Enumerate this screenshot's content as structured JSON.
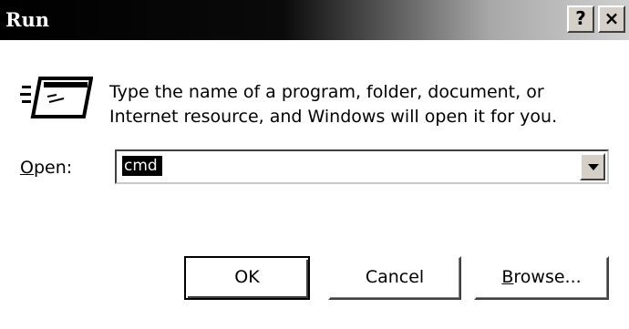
{
  "window": {
    "title": "Run",
    "help_label": "?",
    "close_label": "×"
  },
  "dialog": {
    "icon": "run-program-icon",
    "description_line1": "Type the name of a program, folder, document, or",
    "description_line2": "Internet resource, and Windows will open it for you.",
    "open_label_accel": "O",
    "open_label_rest": "pen:",
    "open_value": "cmd"
  },
  "buttons": {
    "ok_label": "OK",
    "cancel_label": "Cancel",
    "browse_label_accel": "B",
    "browse_label_rest": "rowse..."
  },
  "colors": {
    "titlebar_start": "#000000",
    "titlebar_end": "#d0d0d0",
    "selection": "#000000"
  }
}
